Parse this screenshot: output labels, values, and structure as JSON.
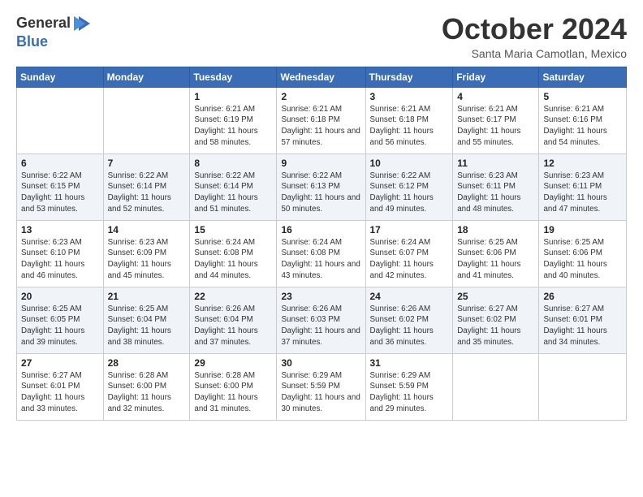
{
  "logo": {
    "line1": "General",
    "line2": "Blue"
  },
  "title": "October 2024",
  "location": "Santa Maria Camotlan, Mexico",
  "days_of_week": [
    "Sunday",
    "Monday",
    "Tuesday",
    "Wednesday",
    "Thursday",
    "Friday",
    "Saturday"
  ],
  "weeks": [
    [
      {
        "day": "",
        "info": ""
      },
      {
        "day": "",
        "info": ""
      },
      {
        "day": "1",
        "info": "Sunrise: 6:21 AM\nSunset: 6:19 PM\nDaylight: 11 hours and 58 minutes."
      },
      {
        "day": "2",
        "info": "Sunrise: 6:21 AM\nSunset: 6:18 PM\nDaylight: 11 hours and 57 minutes."
      },
      {
        "day": "3",
        "info": "Sunrise: 6:21 AM\nSunset: 6:18 PM\nDaylight: 11 hours and 56 minutes."
      },
      {
        "day": "4",
        "info": "Sunrise: 6:21 AM\nSunset: 6:17 PM\nDaylight: 11 hours and 55 minutes."
      },
      {
        "day": "5",
        "info": "Sunrise: 6:21 AM\nSunset: 6:16 PM\nDaylight: 11 hours and 54 minutes."
      }
    ],
    [
      {
        "day": "6",
        "info": "Sunrise: 6:22 AM\nSunset: 6:15 PM\nDaylight: 11 hours and 53 minutes."
      },
      {
        "day": "7",
        "info": "Sunrise: 6:22 AM\nSunset: 6:14 PM\nDaylight: 11 hours and 52 minutes."
      },
      {
        "day": "8",
        "info": "Sunrise: 6:22 AM\nSunset: 6:14 PM\nDaylight: 11 hours and 51 minutes."
      },
      {
        "day": "9",
        "info": "Sunrise: 6:22 AM\nSunset: 6:13 PM\nDaylight: 11 hours and 50 minutes."
      },
      {
        "day": "10",
        "info": "Sunrise: 6:22 AM\nSunset: 6:12 PM\nDaylight: 11 hours and 49 minutes."
      },
      {
        "day": "11",
        "info": "Sunrise: 6:23 AM\nSunset: 6:11 PM\nDaylight: 11 hours and 48 minutes."
      },
      {
        "day": "12",
        "info": "Sunrise: 6:23 AM\nSunset: 6:11 PM\nDaylight: 11 hours and 47 minutes."
      }
    ],
    [
      {
        "day": "13",
        "info": "Sunrise: 6:23 AM\nSunset: 6:10 PM\nDaylight: 11 hours and 46 minutes."
      },
      {
        "day": "14",
        "info": "Sunrise: 6:23 AM\nSunset: 6:09 PM\nDaylight: 11 hours and 45 minutes."
      },
      {
        "day": "15",
        "info": "Sunrise: 6:24 AM\nSunset: 6:08 PM\nDaylight: 11 hours and 44 minutes."
      },
      {
        "day": "16",
        "info": "Sunrise: 6:24 AM\nSunset: 6:08 PM\nDaylight: 11 hours and 43 minutes."
      },
      {
        "day": "17",
        "info": "Sunrise: 6:24 AM\nSunset: 6:07 PM\nDaylight: 11 hours and 42 minutes."
      },
      {
        "day": "18",
        "info": "Sunrise: 6:25 AM\nSunset: 6:06 PM\nDaylight: 11 hours and 41 minutes."
      },
      {
        "day": "19",
        "info": "Sunrise: 6:25 AM\nSunset: 6:06 PM\nDaylight: 11 hours and 40 minutes."
      }
    ],
    [
      {
        "day": "20",
        "info": "Sunrise: 6:25 AM\nSunset: 6:05 PM\nDaylight: 11 hours and 39 minutes."
      },
      {
        "day": "21",
        "info": "Sunrise: 6:25 AM\nSunset: 6:04 PM\nDaylight: 11 hours and 38 minutes."
      },
      {
        "day": "22",
        "info": "Sunrise: 6:26 AM\nSunset: 6:04 PM\nDaylight: 11 hours and 37 minutes."
      },
      {
        "day": "23",
        "info": "Sunrise: 6:26 AM\nSunset: 6:03 PM\nDaylight: 11 hours and 37 minutes."
      },
      {
        "day": "24",
        "info": "Sunrise: 6:26 AM\nSunset: 6:02 PM\nDaylight: 11 hours and 36 minutes."
      },
      {
        "day": "25",
        "info": "Sunrise: 6:27 AM\nSunset: 6:02 PM\nDaylight: 11 hours and 35 minutes."
      },
      {
        "day": "26",
        "info": "Sunrise: 6:27 AM\nSunset: 6:01 PM\nDaylight: 11 hours and 34 minutes."
      }
    ],
    [
      {
        "day": "27",
        "info": "Sunrise: 6:27 AM\nSunset: 6:01 PM\nDaylight: 11 hours and 33 minutes."
      },
      {
        "day": "28",
        "info": "Sunrise: 6:28 AM\nSunset: 6:00 PM\nDaylight: 11 hours and 32 minutes."
      },
      {
        "day": "29",
        "info": "Sunrise: 6:28 AM\nSunset: 6:00 PM\nDaylight: 11 hours and 31 minutes."
      },
      {
        "day": "30",
        "info": "Sunrise: 6:29 AM\nSunset: 5:59 PM\nDaylight: 11 hours and 30 minutes."
      },
      {
        "day": "31",
        "info": "Sunrise: 6:29 AM\nSunset: 5:59 PM\nDaylight: 11 hours and 29 minutes."
      },
      {
        "day": "",
        "info": ""
      },
      {
        "day": "",
        "info": ""
      }
    ]
  ]
}
